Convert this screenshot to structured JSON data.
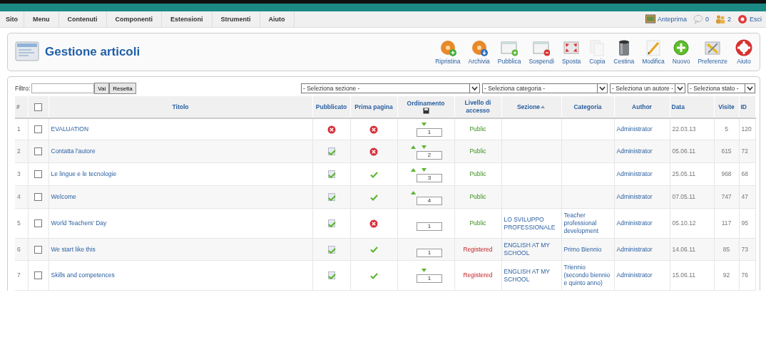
{
  "menu": [
    {
      "label": "Sito"
    },
    {
      "label": "Menu"
    },
    {
      "label": "Contenuti"
    },
    {
      "label": "Componenti"
    },
    {
      "label": "Estensioni"
    },
    {
      "label": "Strumenti"
    },
    {
      "label": "Aiuto"
    }
  ],
  "status": [
    {
      "kind": "preview",
      "label": "Anteprima"
    },
    {
      "kind": "messages",
      "label": "0"
    },
    {
      "kind": "users",
      "label": "2"
    },
    {
      "kind": "logout",
      "label": "Esci"
    }
  ],
  "title": "Gestione articoli",
  "toolbar": [
    {
      "kind": "restore",
      "label": "Ripristina",
      "disabled": false
    },
    {
      "kind": "archive",
      "label": "Archivia",
      "disabled": false
    },
    {
      "kind": "publish",
      "label": "Pubblica",
      "disabled": false
    },
    {
      "kind": "unpublish",
      "label": "Sospendi",
      "disabled": false
    },
    {
      "kind": "move",
      "label": "Sposta",
      "disabled": false
    },
    {
      "kind": "copy",
      "label": "Copia",
      "disabled": true
    },
    {
      "kind": "trash",
      "label": "Cestina",
      "disabled": false
    },
    {
      "kind": "edit",
      "label": "Modifica",
      "disabled": false
    },
    {
      "kind": "new",
      "label": "Nuovo",
      "disabled": false
    },
    {
      "kind": "preferences",
      "label": "Preferenze",
      "disabled": false
    },
    {
      "kind": "help",
      "label": "Aiuto",
      "disabled": false
    }
  ],
  "filter": {
    "label": "Filtro:",
    "buttons": [
      "Vai",
      "Resetta"
    ],
    "dropdowns": [
      {
        "value": "- Seleziona sezione -"
      },
      {
        "value": "- Seleziona categoria -"
      },
      {
        "value": "- Seleziona un autore -"
      },
      {
        "value": "- Seleziona stato -"
      }
    ]
  },
  "columns": [
    {
      "kind": "number",
      "label": "#"
    },
    {
      "kind": "checkbox",
      "checked": false
    },
    {
      "kind": "text",
      "label": "Titolo"
    },
    {
      "kind": "text",
      "label": "Pubblicato"
    },
    {
      "kind": "text",
      "label": "Prima pagina"
    },
    {
      "kind": "order",
      "label": "Ordinamento"
    },
    {
      "kind": "text",
      "label": "Livello di accesso"
    },
    {
      "kind": "sorted",
      "label": "Sezione"
    },
    {
      "kind": "text",
      "label": "Categoria"
    },
    {
      "kind": "text",
      "label": "Author"
    },
    {
      "kind": "text",
      "label": "Data"
    },
    {
      "kind": "text",
      "label": "Visite"
    },
    {
      "kind": "text",
      "label": "ID"
    }
  ],
  "rows": [
    {
      "number": "1",
      "checked": false,
      "title": "EVALUATION",
      "published": false,
      "featured": false,
      "up": false,
      "down": true,
      "order": "1",
      "access": {
        "kind": "public",
        "label": "Public"
      },
      "author": "Administrator",
      "date": "22.03.13",
      "hits": "5",
      "id": "120"
    },
    {
      "number": "2",
      "checked": false,
      "title": "Contatta l'autore",
      "published": true,
      "featured": false,
      "up": true,
      "down": true,
      "order": "2",
      "access": {
        "kind": "public",
        "label": "Public"
      },
      "author": "Administrator",
      "date": "05.06.11",
      "hits": "615",
      "id": "72"
    },
    {
      "number": "3",
      "checked": false,
      "title": "Le lingue e le tecnologie",
      "published": true,
      "featured": true,
      "up": true,
      "down": true,
      "order": "3",
      "access": {
        "kind": "public",
        "label": "Public"
      },
      "author": "Administrator",
      "date": "25.05.11",
      "hits": "968",
      "id": "68"
    },
    {
      "number": "4",
      "checked": false,
      "title": "Welcome",
      "published": true,
      "featured": true,
      "up": true,
      "down": false,
      "order": "4",
      "access": {
        "kind": "public",
        "label": "Public"
      },
      "author": "Administrator",
      "date": "07.05.11",
      "hits": "747",
      "id": "47"
    },
    {
      "number": "5",
      "checked": false,
      "title": "World Teachers' Day",
      "published": true,
      "featured": false,
      "up": false,
      "down": false,
      "order": "1",
      "access": {
        "kind": "public",
        "label": "Public"
      },
      "section": "LO SVILUPPO PROFESSIONALE",
      "category": "Teacher professional development",
      "author": "Administrator",
      "date": "05.10.12",
      "hits": "117",
      "id": "95"
    },
    {
      "number": "6",
      "checked": false,
      "title": "We start like this",
      "published": true,
      "featured": true,
      "up": false,
      "down": false,
      "order": "1",
      "access": {
        "kind": "registered",
        "label": "Registered"
      },
      "section": "ENGLISH AT MY SCHOOL",
      "category": "Primo Biennio",
      "author": "Administrator",
      "date": "14.06.11",
      "hits": "85",
      "id": "73"
    },
    {
      "number": "7",
      "checked": false,
      "title": "Skills and competences",
      "published": true,
      "featured": true,
      "up": false,
      "down": true,
      "order": "1",
      "access": {
        "kind": "registered",
        "label": "Registered"
      },
      "section": "ENGLISH AT MY SCHOOL",
      "category": "Triennio (secondo biennio e quinto anno)",
      "author": "Administrator",
      "date": "15.06.11",
      "hits": "92",
      "id": "76"
    }
  ]
}
